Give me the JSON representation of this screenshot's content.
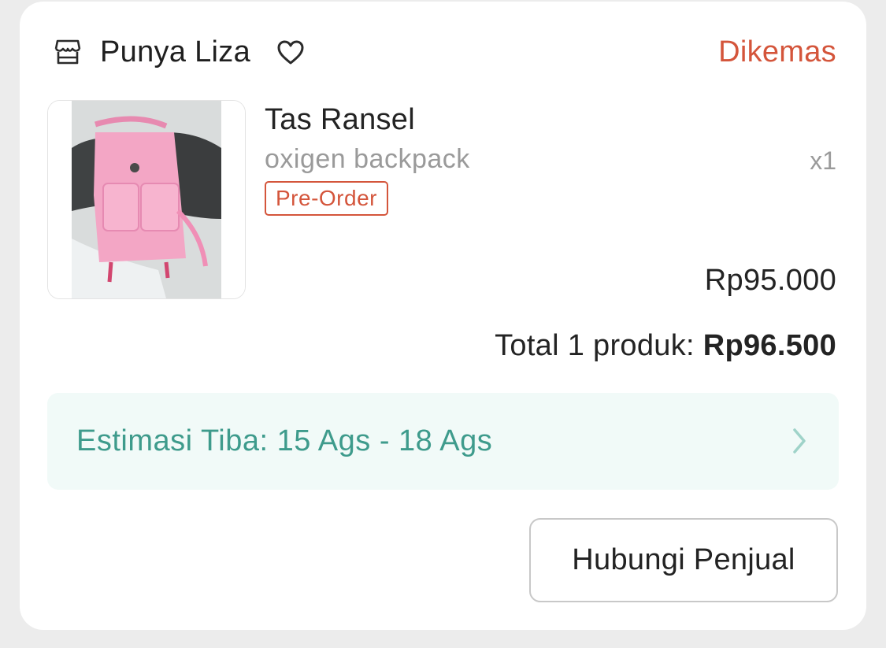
{
  "shop": {
    "name": "Punya Liza",
    "status": "Dikemas",
    "icons": {
      "store": "store-icon",
      "heart": "heart-icon"
    }
  },
  "product": {
    "name": "Tas Ransel",
    "variant": "oxigen backpack",
    "quantity": "x1",
    "badge": "Pre-Order",
    "price": "Rp95.000"
  },
  "summary": {
    "label": "Total 1 produk:",
    "value": "Rp96.500"
  },
  "shipping": {
    "estimate": "Estimasi Tiba: 15 Ags - 18 Ags"
  },
  "actions": {
    "contact_seller": "Hubungi Penjual"
  },
  "colors": {
    "status": "#d4553b",
    "estimate_text": "#3e9b8c",
    "estimate_bg": "#f1faf8"
  }
}
